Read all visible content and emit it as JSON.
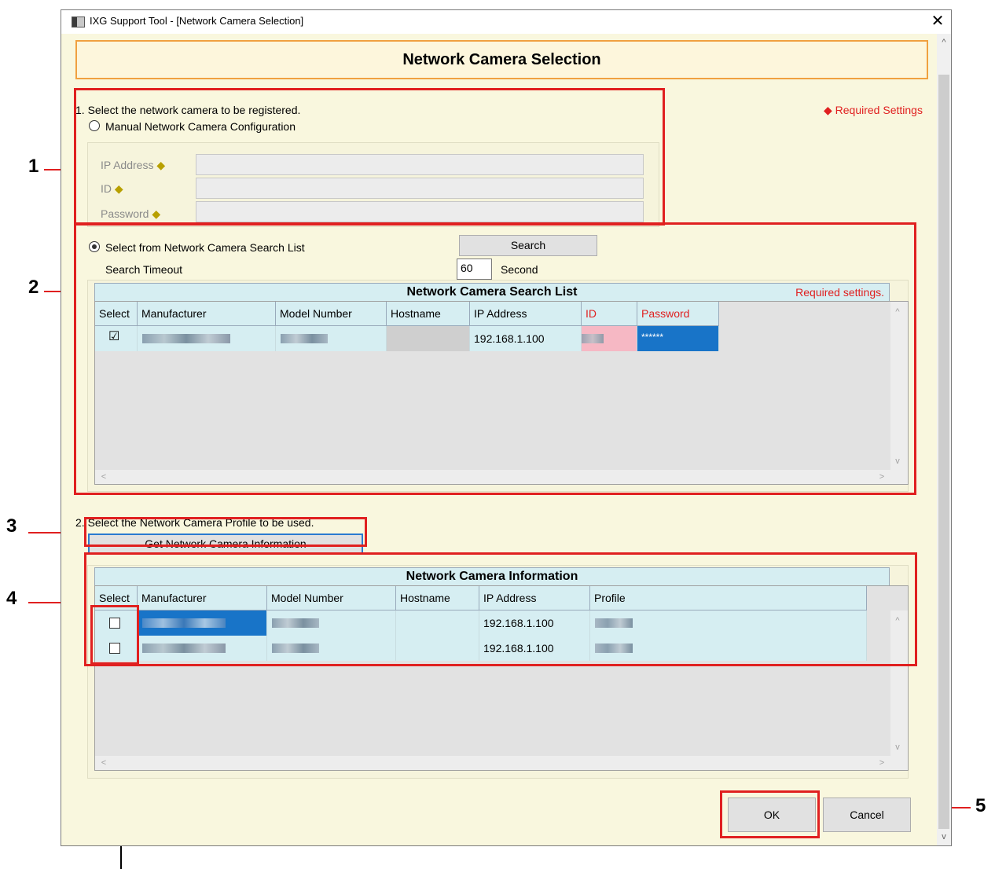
{
  "window": {
    "title": "IXG Support Tool - [Network Camera Selection]",
    "close": "✕"
  },
  "header": {
    "title": "Network Camera Selection"
  },
  "required_settings_note": "◆ Required Settings",
  "section1": {
    "heading": "1. Select the network camera to be registered.",
    "manual_radio_label": "Manual Network Camera Configuration",
    "ip_label": "IP Address",
    "id_label": "ID",
    "password_label": "Password",
    "diamond": "◆"
  },
  "search": {
    "radio_label": "Select from Network Camera Search List",
    "button_label": "Search",
    "timeout_label": "Search Timeout",
    "timeout_value": "60",
    "timeout_unit": "Second"
  },
  "search_list": {
    "title": "Network Camera Search List",
    "required_note": "Required settings.",
    "columns": [
      "Select",
      "Manufacturer",
      "Model Number",
      "Hostname",
      "IP Address",
      "ID",
      "Password"
    ],
    "row": {
      "checked": "☑",
      "ip": "192.168.1.100",
      "password": "******"
    }
  },
  "section2": {
    "heading": "2. Select the Network Camera Profile to be used.",
    "get_info_button": "Get Network Camera Information"
  },
  "info_list": {
    "title": "Network Camera Information",
    "columns": [
      "Select",
      "Manufacturer",
      "Model Number",
      "Hostname",
      "IP Address",
      "Profile"
    ],
    "rows": [
      {
        "ip": "192.168.1.100"
      },
      {
        "ip": "192.168.1.100"
      }
    ]
  },
  "buttons": {
    "ok": "OK",
    "cancel": "Cancel"
  },
  "callouts": [
    "1",
    "2",
    "3",
    "4",
    "5"
  ],
  "scroll": {
    "up": "^",
    "down": "v",
    "left": "<",
    "right": ">"
  },
  "colors": {
    "callout_red": "#e02020",
    "header_border": "#f0a040",
    "table_header": "#d6eef2",
    "selection_blue": "#1874c8"
  }
}
